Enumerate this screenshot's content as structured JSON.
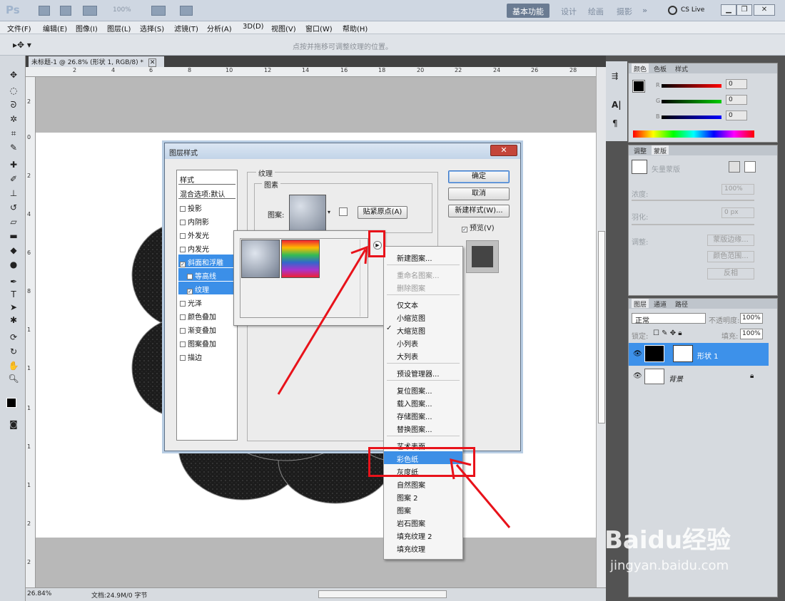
{
  "app": {
    "logo": "Ps",
    "zoom": "100%",
    "workspaces": [
      "基本功能",
      "设计",
      "绘画",
      "摄影"
    ],
    "active_workspace": "基本功能",
    "more": "»",
    "cslive": "CS Live"
  },
  "menu": [
    "文件(F)",
    "编辑(E)",
    "图像(I)",
    "图层(L)",
    "选择(S)",
    "滤镜(T)",
    "分析(A)",
    "3D(D)",
    "视图(V)",
    "窗口(W)",
    "帮助(H)"
  ],
  "options_bar": {
    "hint": "点按并拖移可调整纹理的位置。"
  },
  "document": {
    "tab_title": "未标题-1 @ 26.8% (形状 1, RGB/8) *",
    "close": "✕"
  },
  "ruler": {
    "h": [
      "2",
      "4",
      "6",
      "8",
      "10",
      "12",
      "14",
      "16",
      "18",
      "20",
      "22",
      "24",
      "26",
      "28"
    ],
    "v": [
      "2",
      "0",
      "2",
      "4",
      "6",
      "8",
      "1",
      "1",
      "1",
      "1",
      "1",
      "2",
      "2"
    ]
  },
  "status": {
    "zoom": "26.84%",
    "doc": "文档:24.9M/0 字节"
  },
  "dialog": {
    "title": "图层样式",
    "close": "✕",
    "styles_header": "样式",
    "blend": "混合选项:默认",
    "styles": [
      {
        "label": "投影",
        "checked": false
      },
      {
        "label": "内阴影",
        "checked": false
      },
      {
        "label": "外发光",
        "checked": false
      },
      {
        "label": "内发光",
        "checked": false
      },
      {
        "label": "斜面和浮雕",
        "checked": true,
        "selected": true
      },
      {
        "label": "等高线",
        "checked": false,
        "sub": true,
        "selected": true
      },
      {
        "label": "纹理",
        "checked": true,
        "sub": true,
        "selected": true
      },
      {
        "label": "光泽",
        "checked": false
      },
      {
        "label": "颜色叠加",
        "checked": false
      },
      {
        "label": "渐变叠加",
        "checked": false
      },
      {
        "label": "图案叠加",
        "checked": false
      },
      {
        "label": "描边",
        "checked": false
      }
    ],
    "group_title": "纹理",
    "sub_group": "图素",
    "pattern_label": "图案:",
    "snap_button": "贴紧原点(A)",
    "ok": "确定",
    "cancel": "取消",
    "new_style": "新建样式(W)...",
    "preview": "预览(V)"
  },
  "context_menu": {
    "items": [
      {
        "label": "新建图案...",
        "state": "normal"
      },
      {
        "sep": true
      },
      {
        "label": "重命名图案...",
        "state": "disabled"
      },
      {
        "label": "删除图案",
        "state": "disabled"
      },
      {
        "sep": true
      },
      {
        "label": "仅文本",
        "state": "normal"
      },
      {
        "label": "小缩览图",
        "state": "normal"
      },
      {
        "label": "大缩览图",
        "state": "checked"
      },
      {
        "label": "小列表",
        "state": "normal"
      },
      {
        "label": "大列表",
        "state": "normal"
      },
      {
        "sep": true
      },
      {
        "label": "预设管理器...",
        "state": "normal"
      },
      {
        "sep": true
      },
      {
        "label": "复位图案...",
        "state": "normal"
      },
      {
        "label": "载入图案...",
        "state": "normal"
      },
      {
        "label": "存储图案...",
        "state": "normal"
      },
      {
        "label": "替换图案...",
        "state": "normal"
      },
      {
        "sep": true
      },
      {
        "label": "艺术表面",
        "state": "normal"
      },
      {
        "label": "彩色纸",
        "state": "highlighted"
      },
      {
        "label": "灰度纸",
        "state": "normal"
      },
      {
        "label": "自然图案",
        "state": "normal"
      },
      {
        "label": "图案 2",
        "state": "normal"
      },
      {
        "label": "图案",
        "state": "normal"
      },
      {
        "label": "岩石图案",
        "state": "normal"
      },
      {
        "label": "填充纹理 2",
        "state": "normal"
      },
      {
        "label": "填充纹理",
        "state": "normal"
      }
    ]
  },
  "color_panel": {
    "tabs": [
      "颜色",
      "色板",
      "样式"
    ],
    "channels": [
      {
        "label": "R",
        "value": "0"
      },
      {
        "label": "G",
        "value": "0"
      },
      {
        "label": "B",
        "value": "0"
      }
    ]
  },
  "adjust_panel": {
    "tabs": [
      "调整",
      "蒙版"
    ],
    "mask_label": "矢量蒙版",
    "density_label": "浓度:",
    "density": "100%",
    "feather_label": "羽化:",
    "feather": "0 px",
    "refine_label": "调整:",
    "buttons": [
      "蒙版边缘...",
      "颜色范围...",
      "反相"
    ]
  },
  "layers_panel": {
    "tabs": [
      "图层",
      "通道",
      "路径"
    ],
    "blend_mode": "正常",
    "opacity_label": "不透明度:",
    "opacity": "100%",
    "lock_label": "锁定:",
    "fill_label": "填充:",
    "fill": "100%",
    "layers": [
      {
        "name": "形状 1",
        "selected": true
      },
      {
        "name": "背景",
        "selected": false,
        "locked": true
      }
    ]
  },
  "watermark": {
    "brand": "Baidu经验",
    "url": "jingyan.baidu.com"
  },
  "colors": {
    "accent": "#3b8fe8",
    "annotation": "#e8121a"
  }
}
